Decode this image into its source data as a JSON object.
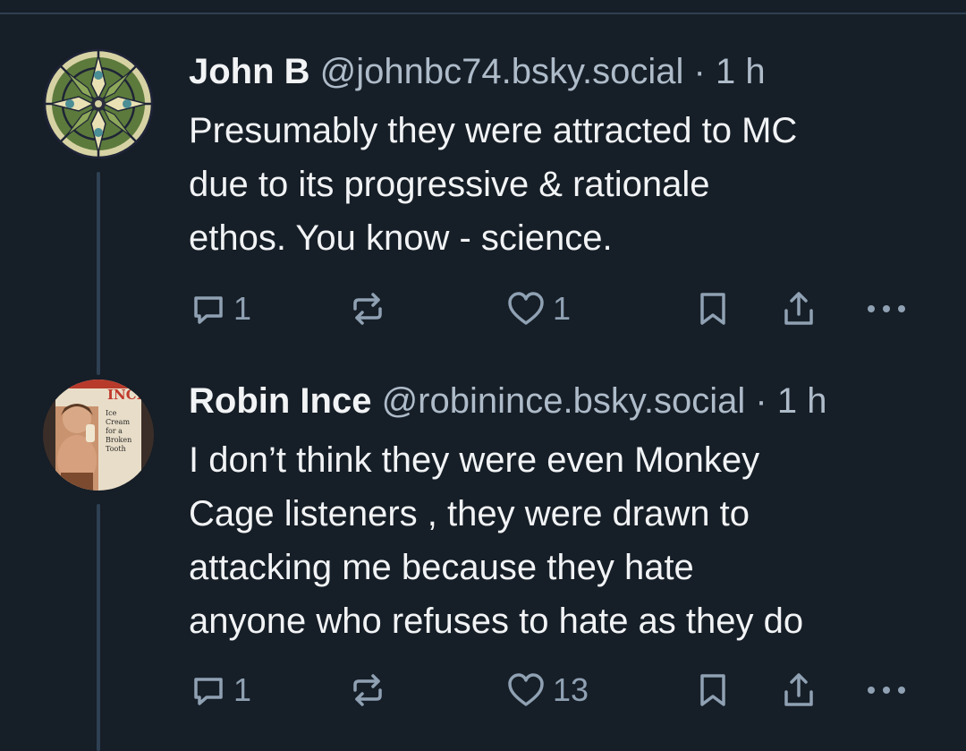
{
  "posts": [
    {
      "author": "John B",
      "handle": "@johnbc74.bsky.social",
      "separator": "·",
      "time": "1 h",
      "text_lines": [
        "Presumably they were attracted to MC",
        "due to its progressive & rationale",
        "ethos. You know - science."
      ],
      "reply_count": "1",
      "repost_count": "",
      "like_count": "1",
      "avatar_icon": "kaleidoscope-avatar"
    },
    {
      "author": "Robin Ince",
      "handle": "@robinince.bsky.social",
      "separator": "·",
      "time": "1 h",
      "text_lines": [
        "I don’t think they were even Monkey",
        "Cage listeners , they were drawn to",
        "attacking me because they hate",
        "anyone who refuses to hate as they do"
      ],
      "reply_count": "1",
      "repost_count": "",
      "like_count": "13",
      "avatar_icon": "book-cover-avatar",
      "avatar_text": [
        "INCE",
        "Ice",
        "Cream",
        "for a",
        "Broken",
        "Tooth"
      ]
    }
  ],
  "colors": {
    "background": "#161e27",
    "divider": "#2e4052",
    "text": "#f1f3f5",
    "muted": "#aebbc9",
    "icon": "#8fa1b3"
  }
}
